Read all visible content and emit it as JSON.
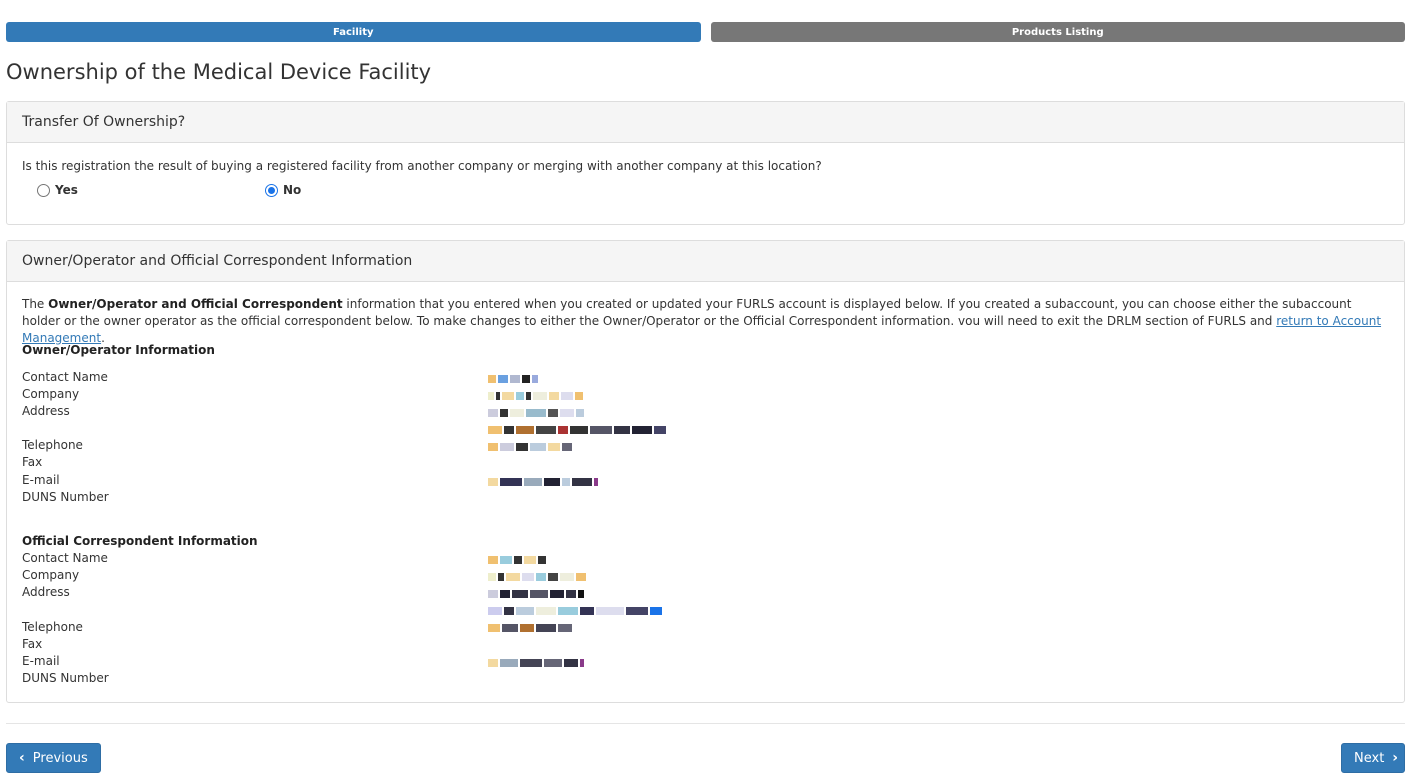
{
  "steps": [
    {
      "label": "Facility",
      "state": "active"
    },
    {
      "label": "Products Listing",
      "state": "inactive"
    }
  ],
  "page_title": "Ownership of the Medical Device Facility",
  "transfer": {
    "heading": "Transfer Of Ownership?",
    "question": "Is this registration the result of buying a registered facility from another company or merging with another company at this location?",
    "options": [
      {
        "label": "Yes",
        "checked": false
      },
      {
        "label": "No",
        "checked": true
      }
    ]
  },
  "owner_panel": {
    "heading": "Owner/Operator and Official Correspondent Information",
    "intro_prefix": "The ",
    "intro_bold": "Owner/Operator and Official Correspondent",
    "intro_text": " information that you entered when you created or updated your FURLS account is displayed below. If you created a subaccount, you can choose either the subaccount holder or the owner operator as the official correspondent below. To make changes to either the Owner/Operator or the Official Correspondent information. vou will need to exit the DRLM section of FURLS and ",
    "intro_link": "return to Account Management",
    "intro_end": ".",
    "owner_section": {
      "title": "Owner/Operator Information",
      "labels": [
        "Contact Name",
        "Company",
        "Address",
        "Telephone",
        "Fax",
        "E-mail",
        "DUNS Number"
      ]
    },
    "correspondent_section": {
      "title": "Official Correspondent Information",
      "labels": [
        "Contact Name",
        "Company",
        "Address",
        "Telephone",
        "Fax",
        "E-mail",
        "DUNS Number"
      ]
    }
  },
  "nav": {
    "previous": "Previous",
    "next": "Next"
  },
  "colors": {
    "primary": "#337ab7",
    "inactive_step": "#777777",
    "panel_heading_bg": "#f5f5f5",
    "border": "#dddddd"
  }
}
